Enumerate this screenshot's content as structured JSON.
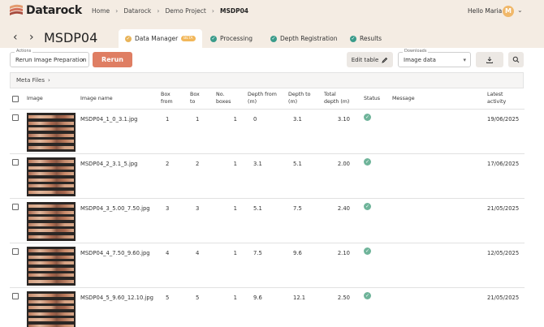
{
  "app": {
    "name": "Datarock"
  },
  "breadcrumb": [
    "Home",
    "Datarock",
    "Demo Project",
    "MSDP04"
  ],
  "user": {
    "greeting": "Hello Maria",
    "initial": "M"
  },
  "page": {
    "title": "MSDP04"
  },
  "tabs": [
    {
      "label": "Data Manager",
      "badge": "BETA",
      "active": true
    },
    {
      "label": "Processing"
    },
    {
      "label": "Depth Registration"
    },
    {
      "label": "Results"
    }
  ],
  "actions": {
    "label": "Actions",
    "value": "Rerun Image Preparation",
    "button": "Rerun"
  },
  "edit_table": "Edit table",
  "downloads": {
    "label": "Downloads",
    "value": "Image data"
  },
  "meta_files": "Meta Files",
  "table": {
    "headers": {
      "image": "Image",
      "image_name": "Image name",
      "box_from_1": "Box",
      "box_from_2": "from",
      "box_to_1": "Box",
      "box_to_2": "to",
      "boxes_1": "No.",
      "boxes_2": "boxes",
      "depth_from_1": "Depth from",
      "depth_from_2": "(m)",
      "depth_to_1": "Depth to",
      "depth_to_2": "(m)",
      "total_1": "Total",
      "total_2": "depth (m)",
      "status": "Status",
      "message": "Message",
      "activity_1": "Latest",
      "activity_2": "activity"
    },
    "rows": [
      {
        "name": "MSDP04_1_0_3.1.jpg",
        "box_from": "1",
        "box_to": "1",
        "boxes": "1",
        "depth_from": "0",
        "depth_to": "3.1",
        "total": "3.10",
        "activity": "19/06/2025"
      },
      {
        "name": "MSDP04_2_3.1_5.jpg",
        "box_from": "2",
        "box_to": "2",
        "boxes": "1",
        "depth_from": "3.1",
        "depth_to": "5.1",
        "total": "2.00",
        "activity": "17/06/2025"
      },
      {
        "name": "MSDP04_3_5.00_7.50.jpg",
        "box_from": "3",
        "box_to": "3",
        "boxes": "1",
        "depth_from": "5.1",
        "depth_to": "7.5",
        "total": "2.40",
        "activity": "21/05/2025"
      },
      {
        "name": "MSDP04_4_7.50_9.60.jpg",
        "box_from": "4",
        "box_to": "4",
        "boxes": "1",
        "depth_from": "7.5",
        "depth_to": "9.6",
        "total": "2.10",
        "activity": "12/05/2025"
      },
      {
        "name": "MSDP04_5_9.60_12.10.jpg",
        "box_from": "5",
        "box_to": "5",
        "boxes": "1",
        "depth_from": "9.6",
        "depth_to": "12.1",
        "total": "2.50",
        "activity": "21/05/2025"
      }
    ]
  },
  "colors": {
    "accent": "#df7e63",
    "topbar": "#f4ece3",
    "status_ok": "#6fb49a",
    "tab_check": "#3a9b8a"
  }
}
